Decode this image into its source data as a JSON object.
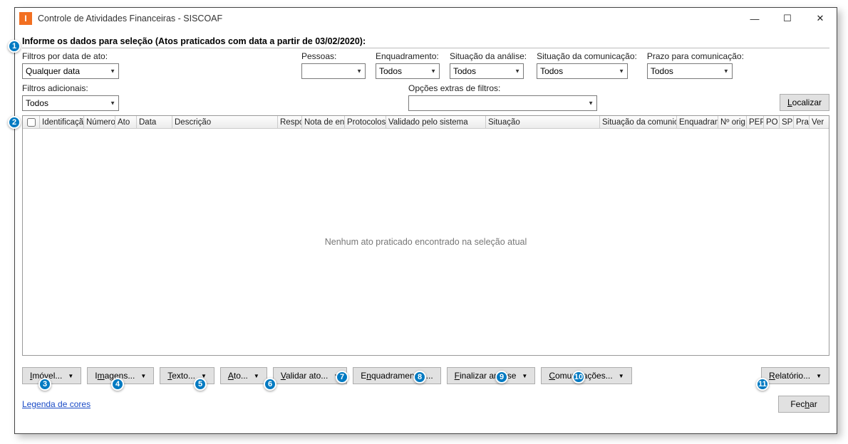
{
  "window": {
    "title": "Controle de Atividades Financeiras - SISCOAF",
    "app_icon_letter": "I"
  },
  "header": {
    "instruction": "Informe os dados para seleção (Atos praticados com data a partir de 03/02/2020):"
  },
  "filters": {
    "data_ato": {
      "label": "Filtros por data de ato:",
      "value": "Qualquer data"
    },
    "pessoas": {
      "label": "Pessoas:",
      "value": ""
    },
    "enquadramento": {
      "label": "Enquadramento:",
      "value": "Todos"
    },
    "sit_analise": {
      "label": "Situação da análise:",
      "value": "Todos"
    },
    "sit_comunicacao": {
      "label": "Situação da comunicação:",
      "value": "Todos"
    },
    "prazo": {
      "label": "Prazo para comunicação:",
      "value": "Todos"
    },
    "adicionais": {
      "label": "Filtros adicionais:",
      "value": "Todos"
    },
    "extras": {
      "label": "Opções extras de filtros:",
      "value": ""
    }
  },
  "buttons": {
    "localizar": "Localizar",
    "imovel": "Imóvel...",
    "imagens": "Imagens...",
    "texto": "Texto...",
    "ato": "Ato...",
    "validar": "Validar ato...",
    "enquadramentos": "Enquadramentos...",
    "finalizar": "Finalizar análise",
    "comunicacoes": "Comunicações...",
    "relatorio": "Relatório...",
    "fechar": "Fechar"
  },
  "grid": {
    "columns": [
      "",
      "Identificação",
      "Número",
      "Ato",
      "Data",
      "Descrição",
      "Respo",
      "Nota de ent",
      "Protocolos",
      "Validado pelo sistema",
      "Situação",
      "Situação da comunica",
      "Enquadram",
      "Nº orig",
      "PEP",
      "PO",
      "SP",
      "Pra",
      "Ver"
    ],
    "empty_message": "Nenhum ato praticado encontrado na seleção atual"
  },
  "footer": {
    "legend": "Legenda de cores"
  },
  "balloons": [
    "1",
    "2",
    "3",
    "4",
    "5",
    "6",
    "7",
    "8",
    "9",
    "10",
    "11"
  ]
}
